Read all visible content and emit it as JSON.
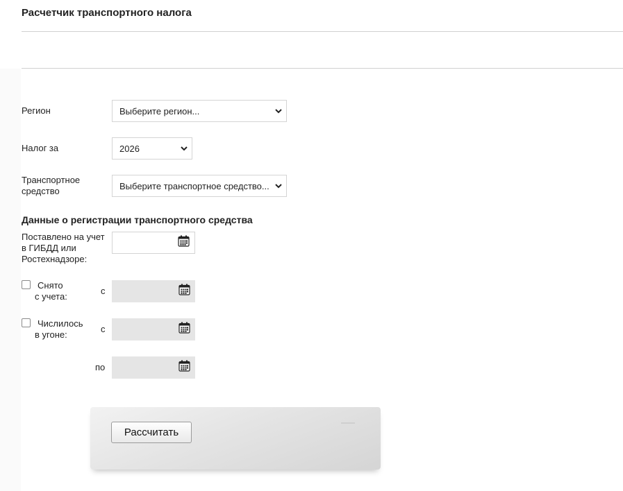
{
  "header": {
    "title": "Расчетчик транспортного налога"
  },
  "form": {
    "region": {
      "label": "Регион",
      "value": "Выберите регион..."
    },
    "tax_year": {
      "label": "Налог за",
      "value": "2026"
    },
    "vehicle": {
      "label_line1": "Транспортное",
      "label_line2": "средство",
      "value": "Выберите транспортное средство..."
    }
  },
  "registration": {
    "title": "Данные о регистрации транспортного средства",
    "registered": {
      "line1": "Поставлено на учет",
      "line2": "в ГИБДД или",
      "line3": "Ростехнадзоре:"
    },
    "deregistered": {
      "line1": "Снято",
      "line2": "с учета:",
      "from_label": "с",
      "checked": false
    },
    "stolen": {
      "line1": "Числилось",
      "line2": "в угоне:",
      "from_label": "с",
      "to_label": "по",
      "checked": false
    }
  },
  "actions": {
    "calculate_label": "Рассчитать"
  },
  "colors": {
    "disabled_field": "#e5e5e5",
    "border": "#d4d4d4",
    "text": "#222222"
  }
}
